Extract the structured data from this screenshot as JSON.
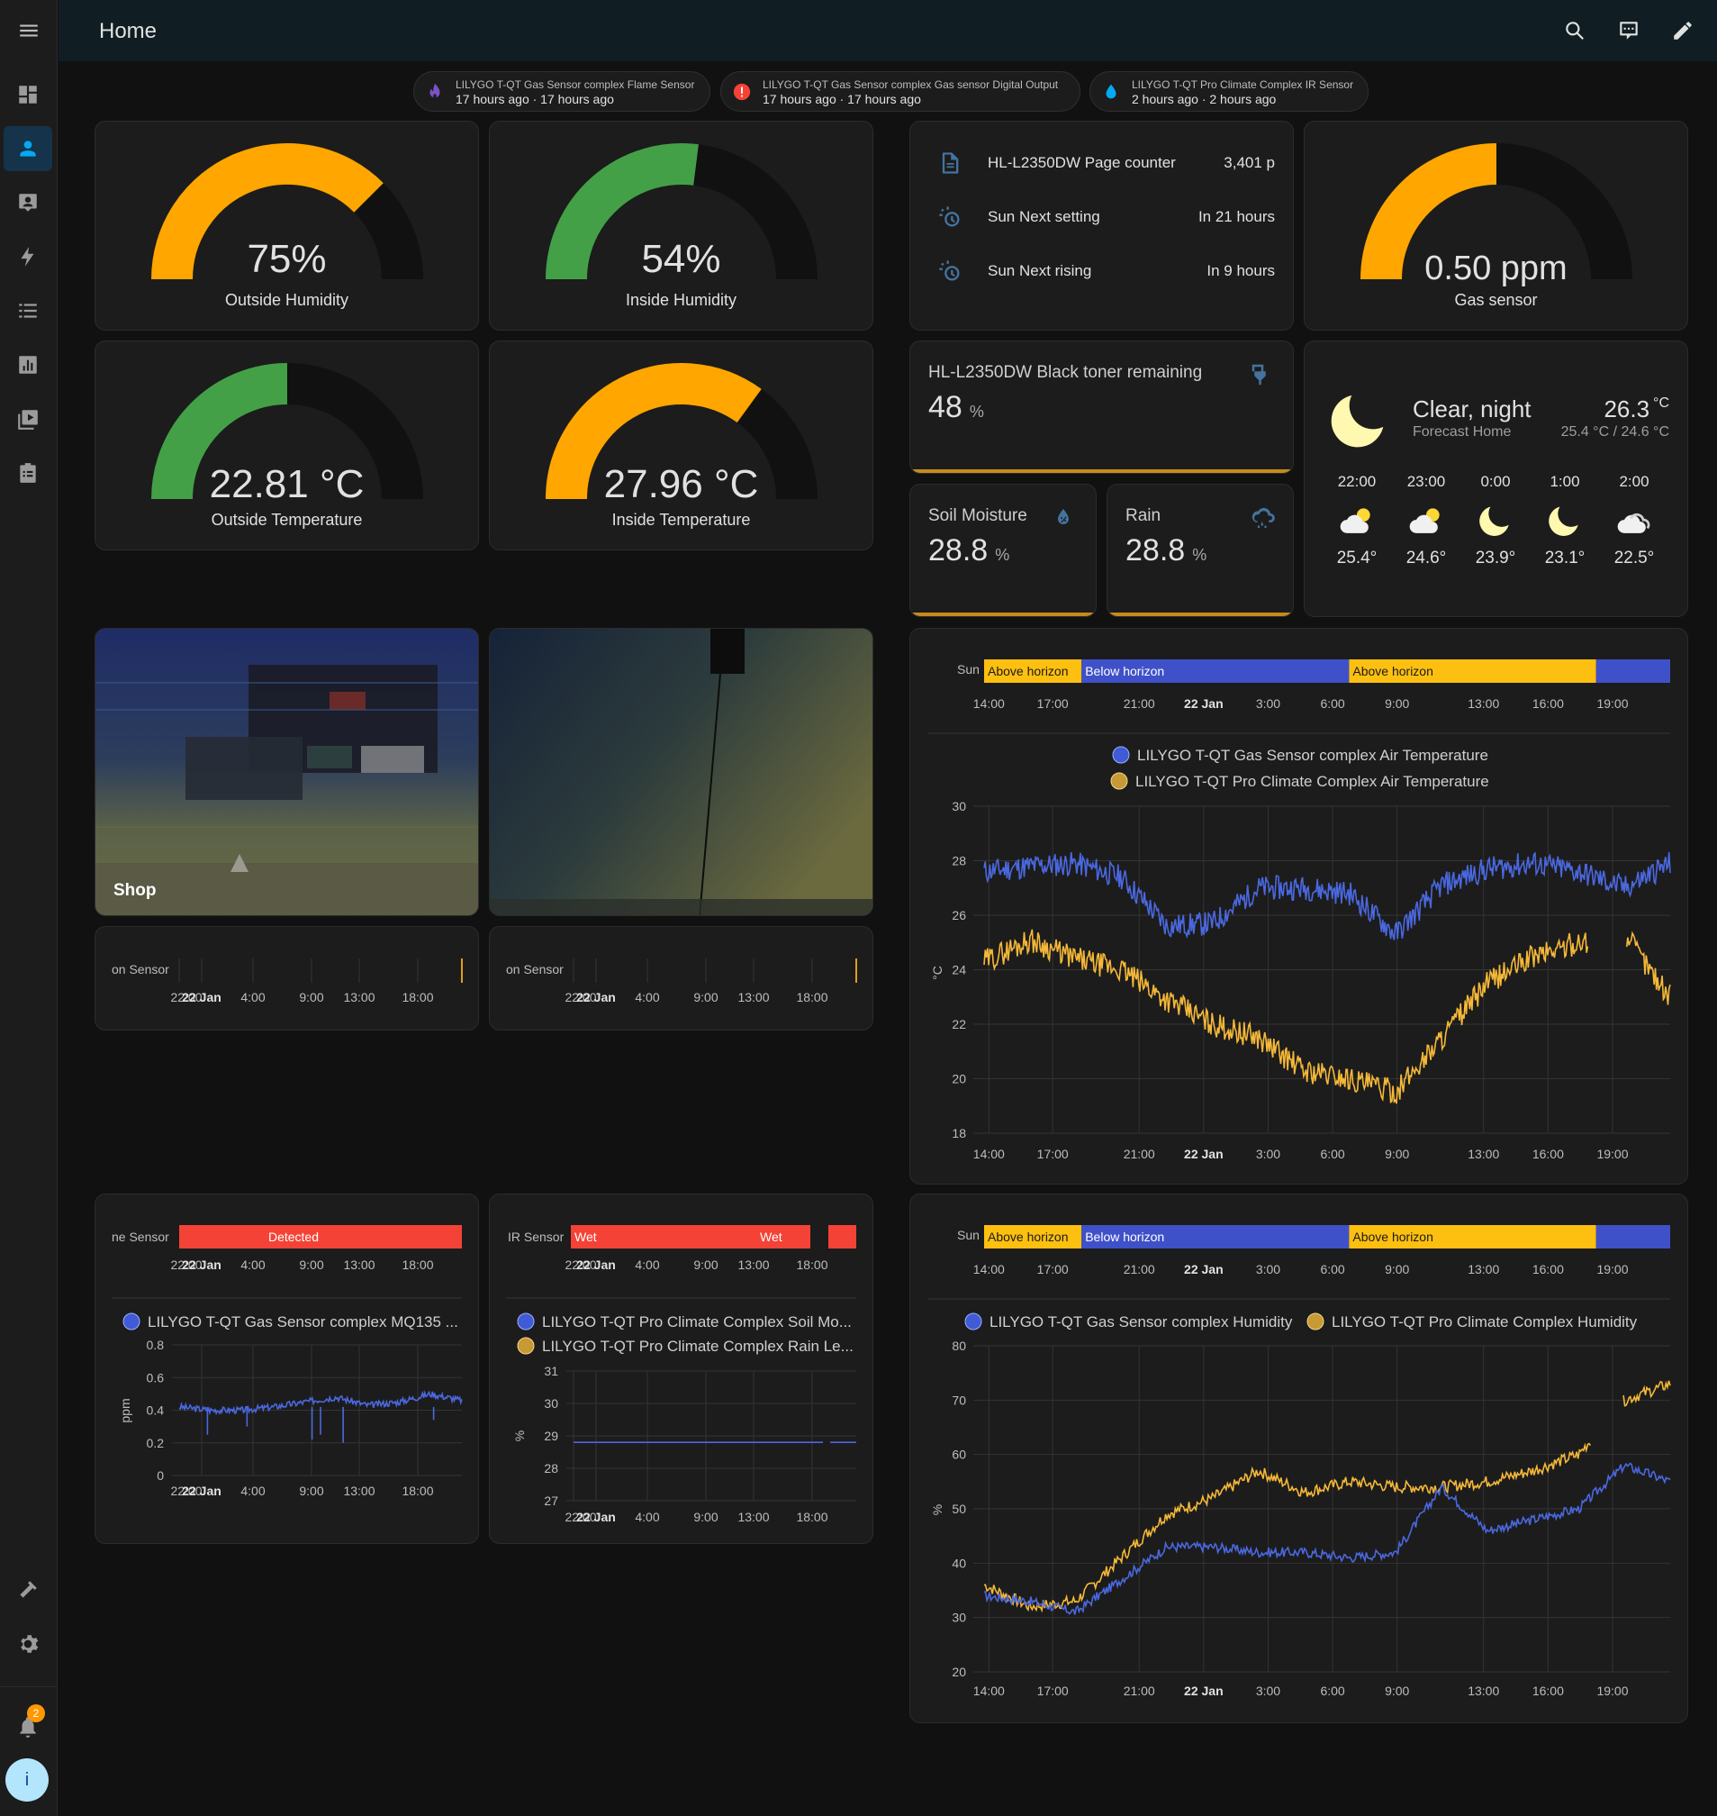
{
  "header": {
    "title": "Home"
  },
  "sidebar": {
    "notification_count": "2",
    "avatar_initial": "i"
  },
  "badges": [
    {
      "title": "LILYGO T-QT Gas Sensor complex Flame Sensor",
      "sub": "17 hours ago · 17 hours ago",
      "icon": "fire-icon",
      "color": "#7b52c4"
    },
    {
      "title": "LILYGO T-QT Gas Sensor complex Gas sensor Digital Output",
      "sub": "17 hours ago · 17 hours ago",
      "icon": "alert-icon",
      "color": "#f44336"
    },
    {
      "title": "LILYGO T-QT Pro Climate Complex IR Sensor",
      "sub": "2 hours ago · 2 hours ago",
      "icon": "water-icon",
      "color": "#03a9f4"
    }
  ],
  "gauges": [
    {
      "value": "75%",
      "name": "Outside Humidity",
      "fraction": 0.75,
      "color": "#ffa600"
    },
    {
      "value": "54%",
      "name": "Inside Humidity",
      "fraction": 0.54,
      "color": "#43a047"
    },
    {
      "value": "22.81 °C",
      "name": "Outside Temperature",
      "fraction": 0.5,
      "color": "#43a047"
    },
    {
      "value": "27.96 °C",
      "name": "Inside Temperature",
      "fraction": 0.7,
      "color": "#ffa600"
    },
    {
      "value": "0.50 ppm",
      "name": "Gas sensor",
      "fraction": 0.5,
      "color": "#ffa600"
    }
  ],
  "entities": [
    {
      "name": "HL-L2350DW Page counter",
      "value": "3,401 p",
      "icon": "file-document-icon"
    },
    {
      "name": "Sun Next setting",
      "value": "In 21 hours",
      "icon": "sun-clock-icon"
    },
    {
      "name": "Sun Next rising",
      "value": "In 9 hours",
      "icon": "sun-clock-icon"
    }
  ],
  "sensors": {
    "toner": {
      "name": "HL-L2350DW Black toner remaining",
      "value": "48",
      "unit": "%",
      "icon": "printer-toner-icon"
    },
    "soil": {
      "name": "Soil Moisture",
      "value": "28.8",
      "unit": "%",
      "icon": "water-percent-icon"
    },
    "rain": {
      "name": "Rain",
      "value": "28.8",
      "unit": "%",
      "icon": "weather-rainy-icon"
    }
  },
  "weather": {
    "condition": "Clear, night",
    "location": "Forecast Home",
    "temp": "26.3",
    "temp_unit": "°C",
    "range": "25.4 °C / 24.6 °C",
    "forecast": [
      {
        "time": "22:00",
        "temp": "25.4°",
        "icon": "partly-cloudy-icon"
      },
      {
        "time": "23:00",
        "temp": "24.6°",
        "icon": "partly-cloudy-icon"
      },
      {
        "time": "0:00",
        "temp": "23.9°",
        "icon": "moon-icon"
      },
      {
        "time": "1:00",
        "temp": "23.1°",
        "icon": "moon-icon"
      },
      {
        "time": "2:00",
        "temp": "22.5°",
        "icon": "cloudy-icon"
      }
    ]
  },
  "cameras": {
    "shop_label": "Shop"
  },
  "small_timelines": {
    "cam1_label": "on Sensor",
    "cam2_label": "on Sensor",
    "ticks": [
      "22:00",
      "22 Jan",
      "4:00",
      "9:00",
      "13:00",
      "18:00"
    ],
    "flame_label": "ne Sensor",
    "flame_state": "Detected",
    "ir_label": "IR Sensor",
    "ir_state_1": "Wet",
    "ir_state_2": "Wet"
  },
  "sun_timeline": {
    "label": "Sun",
    "segments": [
      "Above horizon",
      "Below horizon",
      "Above horizon"
    ],
    "ticks": [
      "14:00",
      "17:00",
      "21:00",
      "22 Jan",
      "3:00",
      "6:00",
      "9:00",
      "13:00",
      "16:00",
      "19:00"
    ]
  },
  "colors": {
    "blue_series": "#3f5bd6",
    "amber_series": "#f5b838",
    "above_horizon": "#fdc010",
    "below_horizon": "#3f51c8",
    "wet": "#f44336"
  },
  "chart_data": [
    {
      "type": "line",
      "title": "",
      "ylabel": "°C",
      "ylim": [
        18,
        30
      ],
      "x": [
        "14:00",
        "17:00",
        "21:00",
        "22 Jan",
        "3:00",
        "6:00",
        "9:00",
        "13:00",
        "16:00",
        "19:00"
      ],
      "series": [
        {
          "name": "LILYGO T-QT Gas Sensor complex Air Temperature",
          "values": [
            27.6,
            27.8,
            27.9,
            27.4,
            25.6,
            25.7,
            27.0,
            27.0,
            26.8,
            25.3,
            27.1,
            27.7,
            27.9,
            27.6,
            27.0,
            27.9
          ]
        },
        {
          "name": "LILYGO T-QT Pro Climate Complex Air Temperature",
          "values": [
            24.3,
            25.1,
            24.4,
            24.0,
            22.9,
            22.0,
            21.5,
            20.3,
            20.0,
            19.5,
            21.5,
            23.5,
            24.5,
            25.0,
            25.3,
            23.0
          ]
        }
      ]
    },
    {
      "type": "line",
      "title": "",
      "ylabel": "%",
      "ylim": [
        20,
        80
      ],
      "x": [
        "14:00",
        "17:00",
        "21:00",
        "22 Jan",
        "3:00",
        "6:00",
        "9:00",
        "13:00",
        "16:00",
        "19:00"
      ],
      "series": [
        {
          "name": "LILYGO T-QT Gas Sensor complex Humidity",
          "values": [
            34,
            33,
            31,
            37,
            43,
            43,
            42,
            42,
            41,
            42,
            54,
            46,
            48,
            50,
            58,
            55
          ]
        },
        {
          "name": "LILYGO T-QT Pro Climate Complex Humidity",
          "values": [
            36,
            32,
            33,
            41,
            49,
            52,
            57,
            53,
            55,
            54,
            54,
            55,
            57,
            60,
            70,
            73
          ]
        }
      ]
    },
    {
      "type": "line",
      "title": "",
      "ylabel": "ppm",
      "ylim": [
        0,
        0.8
      ],
      "x": [
        "22:00",
        "22 Jan",
        "4:00",
        "9:00",
        "13:00",
        "18:00"
      ],
      "series": [
        {
          "name": "LILYGO T-QT Gas Sensor complex MQ135 ...",
          "values": [
            0.42,
            0.4,
            0.4,
            0.42,
            0.45,
            0.48,
            0.43,
            0.45,
            0.5,
            0.46
          ]
        }
      ]
    },
    {
      "type": "line",
      "title": "",
      "ylabel": "%",
      "ylim": [
        27,
        31
      ],
      "x": [
        "22:00",
        "22 Jan",
        "4:00",
        "9:00",
        "13:00",
        "18:00"
      ],
      "series": [
        {
          "name": "LILYGO T-QT Pro Climate Complex Soil Mo...",
          "values": [
            28.8,
            28.8,
            28.8,
            28.8,
            28.8,
            28.8
          ]
        },
        {
          "name": "LILYGO T-QT Pro Climate Complex Rain Le...",
          "values": [
            28.8,
            28.8,
            28.8,
            28.8,
            28.8,
            28.8
          ]
        }
      ]
    }
  ]
}
